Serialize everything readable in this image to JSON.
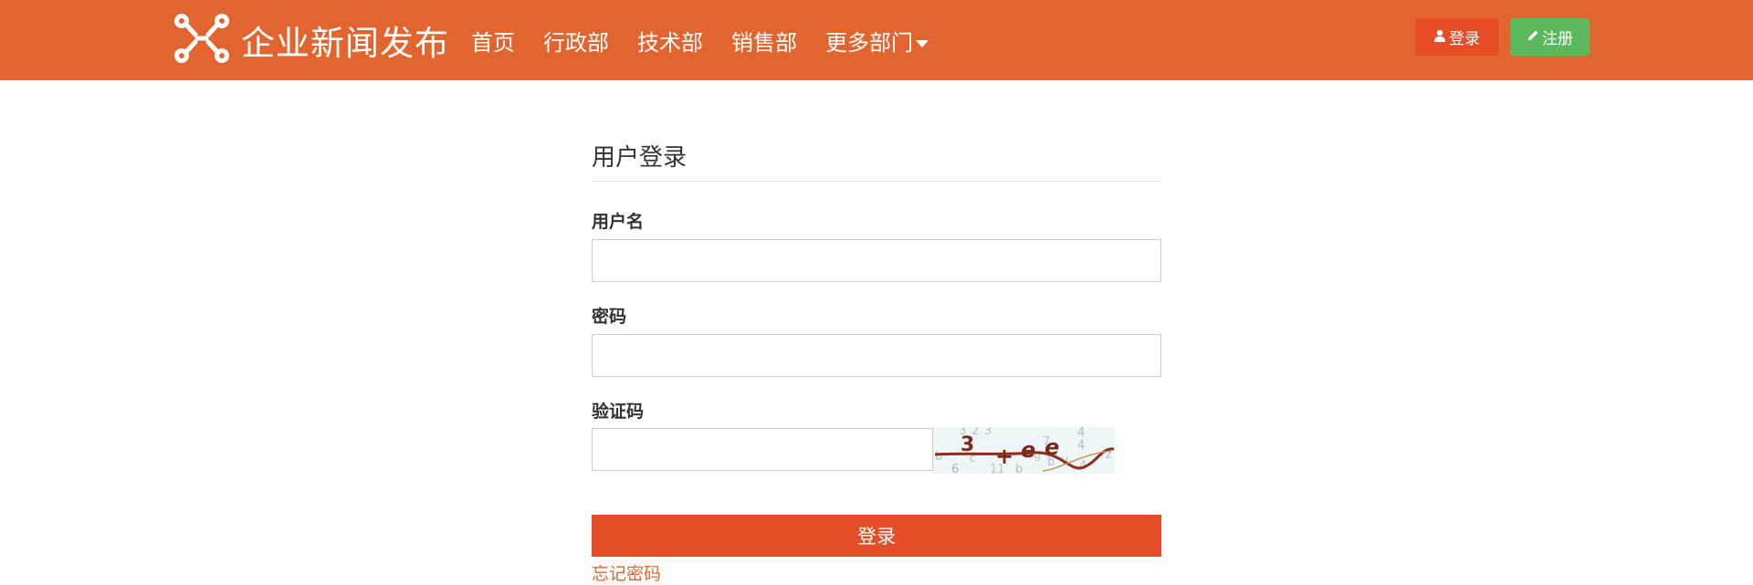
{
  "brand": {
    "name": "企业新闻发布",
    "icon": "network-nodes-icon"
  },
  "nav": {
    "items": [
      {
        "label": "首页"
      },
      {
        "label": "行政部"
      },
      {
        "label": "技术部"
      },
      {
        "label": "销售部"
      },
      {
        "label": "更多部门"
      }
    ]
  },
  "top_actions": {
    "login_label": "登录",
    "login_icon": "user-icon",
    "register_label": "注册",
    "register_icon": "pencil-icon"
  },
  "form": {
    "title": "用户登录",
    "username": {
      "label": "用户名",
      "value": ""
    },
    "password": {
      "label": "密码",
      "value": ""
    },
    "captcha": {
      "label": "验证码",
      "value": ""
    },
    "submit_label": "登录",
    "forgot_label": "忘记密码"
  },
  "colors": {
    "navbar": "#e26530",
    "login_button": "#e64d25",
    "register_button": "#5cb85c",
    "submit_button": "#e44d26",
    "link": "#e26530"
  }
}
